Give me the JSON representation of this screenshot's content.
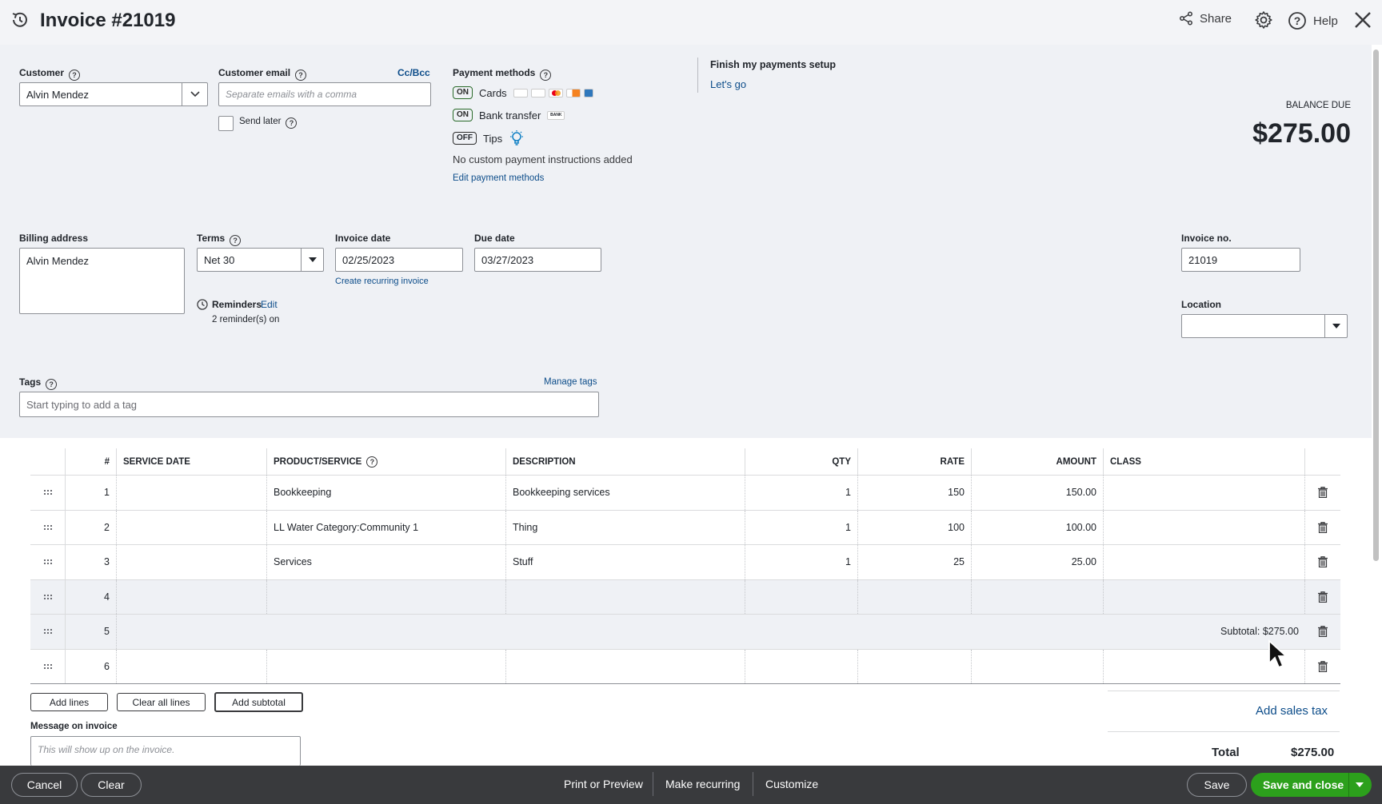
{
  "header": {
    "title": "Invoice #21019",
    "share_label": "Share",
    "help_label": "Help"
  },
  "customer": {
    "label": "Customer",
    "value": "Alvin Mendez"
  },
  "customer_email": {
    "label": "Customer email",
    "cc_bcc": "Cc/Bcc",
    "placeholder": "Separate emails with a comma",
    "send_later": "Send later"
  },
  "payment_methods": {
    "label": "Payment methods",
    "cards_toggle": "ON",
    "cards_label": "Cards",
    "bank_toggle": "ON",
    "bank_label": "Bank transfer",
    "bank_badge": "BANK",
    "tips_toggle": "OFF",
    "tips_label": "Tips",
    "no_instructions": "No custom payment instructions added",
    "edit_link": "Edit payment methods"
  },
  "payments_setup": {
    "title": "Finish my payments setup",
    "link": "Let's go"
  },
  "balance": {
    "label": "BALANCE DUE",
    "amount": "$275.00"
  },
  "billing": {
    "label": "Billing address",
    "value": "Alvin Mendez"
  },
  "terms": {
    "label": "Terms",
    "value": "Net 30"
  },
  "invoice_date": {
    "label": "Invoice date",
    "value": "02/25/2023",
    "recurring_link": "Create recurring invoice"
  },
  "due_date": {
    "label": "Due date",
    "value": "03/27/2023"
  },
  "reminders": {
    "label": "Reminders",
    "edit": "Edit",
    "status": "2 reminder(s) on"
  },
  "invoice_no": {
    "label": "Invoice no.",
    "value": "21019"
  },
  "location": {
    "label": "Location",
    "value": ""
  },
  "tags": {
    "label": "Tags",
    "manage": "Manage tags",
    "placeholder": "Start typing to add a tag"
  },
  "table": {
    "headers": [
      "#",
      "SERVICE DATE",
      "PRODUCT/SERVICE",
      "DESCRIPTION",
      "QTY",
      "RATE",
      "AMOUNT",
      "CLASS"
    ],
    "rows": [
      {
        "num": "1",
        "date": "",
        "product": "Bookkeeping",
        "description": "Bookkeeping services",
        "qty": "1",
        "rate": "150",
        "amount": "150.00",
        "class": ""
      },
      {
        "num": "2",
        "date": "",
        "product": "LL Water Category:Community 1",
        "description": "Thing",
        "qty": "1",
        "rate": "100",
        "amount": "100.00",
        "class": ""
      },
      {
        "num": "3",
        "date": "",
        "product": "Services",
        "description": "Stuff",
        "qty": "1",
        "rate": "25",
        "amount": "25.00",
        "class": ""
      },
      {
        "num": "4",
        "date": "",
        "product": "",
        "description": "",
        "qty": "",
        "rate": "",
        "amount": "",
        "class": ""
      }
    ],
    "subtotal_row_num": "5",
    "subtotal_text": "Subtotal: $275.00",
    "last_row_num": "6"
  },
  "actions": {
    "add_lines": "Add lines",
    "clear_all": "Clear all lines",
    "add_subtotal": "Add subtotal"
  },
  "message": {
    "label": "Message on invoice",
    "placeholder": "This will show up on the invoice."
  },
  "totals": {
    "add_tax": "Add sales tax",
    "total_label": "Total",
    "total_value": "$275.00"
  },
  "footer": {
    "cancel": "Cancel",
    "clear": "Clear",
    "print_preview": "Print or Preview",
    "make_recurring": "Make recurring",
    "customize": "Customize",
    "save": "Save",
    "save_close": "Save and close"
  },
  "colors": {
    "primary_green": "#2ca01c",
    "link_blue": "#0d4d8a",
    "footer_bg": "#393a3d",
    "form_bg": "#eff1f5"
  }
}
